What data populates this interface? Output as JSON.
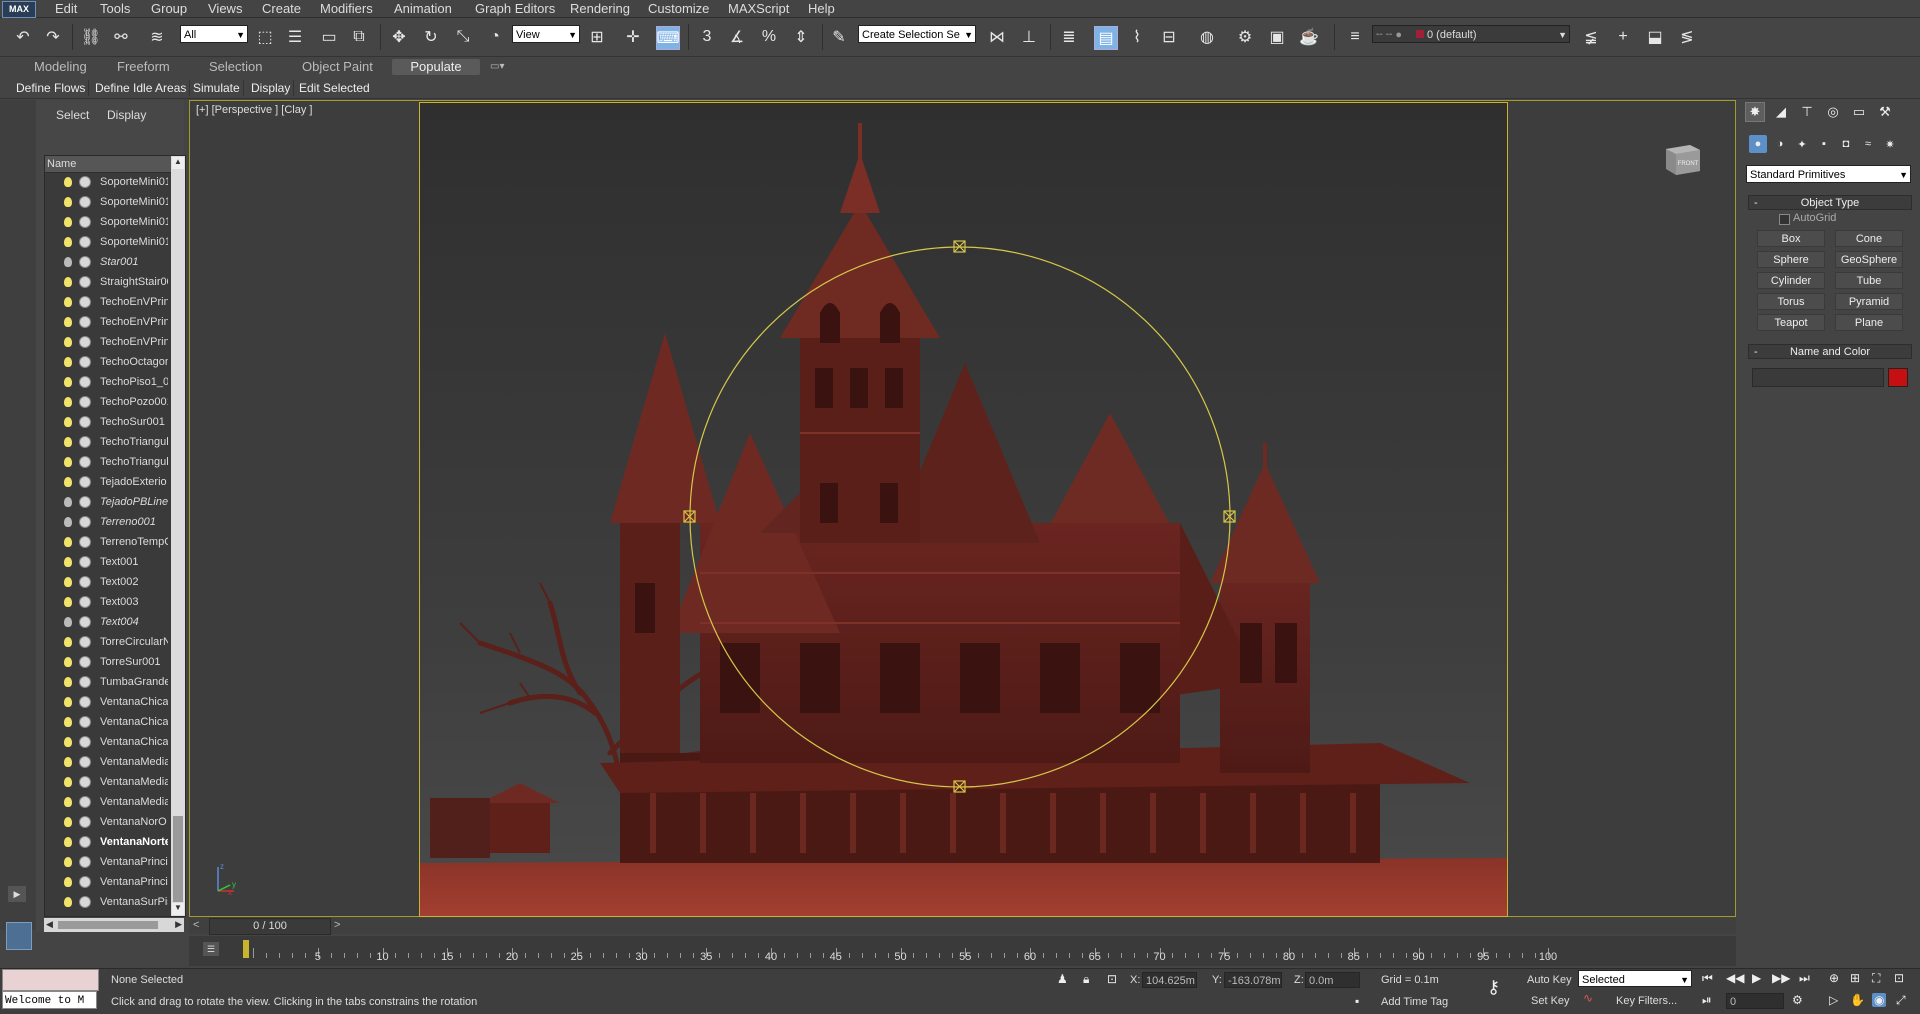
{
  "app": {
    "logo": "MAX"
  },
  "menu": [
    "Edit",
    "Tools",
    "Group",
    "Views",
    "Create",
    "Modifiers",
    "Animation",
    "Graph Editors",
    "Rendering",
    "Customize",
    "MAXScript",
    "Help"
  ],
  "toolbar": {
    "selection_filter": "All",
    "ref_coord": "View",
    "named_selection_placeholder": "Create Selection Se",
    "layer": "0 (default)"
  },
  "ribbon": {
    "tabs": [
      "Modeling",
      "Freeform",
      "Selection",
      "Object Paint",
      "Populate"
    ],
    "active_tab": "Populate",
    "buttons": [
      "Define Flows",
      "Define Idle Areas",
      "Simulate",
      "Display",
      "Edit Selected"
    ]
  },
  "scene_explorer": {
    "tabs": [
      "Select",
      "Display"
    ],
    "column_header": "Name",
    "items": [
      {
        "name": "SoporteMini01",
        "style": "normal",
        "light": true
      },
      {
        "name": "SoporteMini01",
        "style": "normal",
        "light": true
      },
      {
        "name": "SoporteMini01",
        "style": "normal",
        "light": true
      },
      {
        "name": "SoporteMini01",
        "style": "normal",
        "light": true
      },
      {
        "name": "Star001",
        "style": "italic",
        "light": false
      },
      {
        "name": "StraightStair00",
        "style": "normal",
        "light": true
      },
      {
        "name": "TechoEnVPrinc",
        "style": "normal",
        "light": true
      },
      {
        "name": "TechoEnVPrinc",
        "style": "normal",
        "light": true
      },
      {
        "name": "TechoEnVPrinc",
        "style": "normal",
        "light": true
      },
      {
        "name": "TechoOctagon",
        "style": "normal",
        "light": true
      },
      {
        "name": "TechoPiso1_00",
        "style": "normal",
        "light": true
      },
      {
        "name": "TechoPozo001",
        "style": "normal",
        "light": true
      },
      {
        "name": "TechoSur001",
        "style": "normal",
        "light": true
      },
      {
        "name": "TechoTriangul",
        "style": "normal",
        "light": true
      },
      {
        "name": "TechoTriangul",
        "style": "normal",
        "light": true
      },
      {
        "name": "TejadoExterio",
        "style": "normal",
        "light": true
      },
      {
        "name": "TejadoPBLine",
        "style": "italic",
        "light": false
      },
      {
        "name": "Terreno001",
        "style": "italic",
        "light": false
      },
      {
        "name": "TerrenoTempC",
        "style": "normal",
        "light": true
      },
      {
        "name": "Text001",
        "style": "normal",
        "light": true
      },
      {
        "name": "Text002",
        "style": "normal",
        "light": true
      },
      {
        "name": "Text003",
        "style": "normal",
        "light": true
      },
      {
        "name": "Text004",
        "style": "italic",
        "light": false
      },
      {
        "name": "TorreCircularN",
        "style": "normal",
        "light": true
      },
      {
        "name": "TorreSur001",
        "style": "normal",
        "light": true
      },
      {
        "name": "TumbaGrande",
        "style": "normal",
        "light": true
      },
      {
        "name": "VentanaChica",
        "style": "normal",
        "light": true
      },
      {
        "name": "VentanaChica",
        "style": "normal",
        "light": true
      },
      {
        "name": "VentanaChica",
        "style": "normal",
        "light": true
      },
      {
        "name": "VentanaMedia",
        "style": "normal",
        "light": true
      },
      {
        "name": "VentanaMedia",
        "style": "normal",
        "light": true
      },
      {
        "name": "VentanaMedia",
        "style": "normal",
        "light": true
      },
      {
        "name": "VentanaNorO",
        "style": "normal",
        "light": true
      },
      {
        "name": "VentanaNorte",
        "style": "bold",
        "light": true
      },
      {
        "name": "VentanaPrinci",
        "style": "normal",
        "light": true
      },
      {
        "name": "VentanaPrinci",
        "style": "normal",
        "light": true
      },
      {
        "name": "VentanaSurPis",
        "style": "normal",
        "light": true
      }
    ]
  },
  "viewport": {
    "label": "[+] [Perspective ] [Clay ]",
    "viewcube_label": "FRONT"
  },
  "command_panel": {
    "category": "Standard Primitives",
    "object_type_title": "Object Type",
    "autogrid_label": "AutoGrid",
    "primitives": [
      "Box",
      "Cone",
      "Sphere",
      "GeoSphere",
      "Cylinder",
      "Tube",
      "Torus",
      "Pyramid",
      "Teapot",
      "Plane"
    ],
    "name_color_title": "Name and Color",
    "object_color": "#c41010"
  },
  "timeline": {
    "frame_display": "0 / 100",
    "ticks": [
      "5",
      "10",
      "15",
      "20",
      "25",
      "30",
      "35",
      "40",
      "45",
      "50",
      "55",
      "60",
      "65",
      "70",
      "75",
      "80",
      "85",
      "90",
      "95",
      "100"
    ]
  },
  "status": {
    "maxscript_listener": "Welcome to M",
    "selection_status": "None Selected",
    "prompt": "Click and drag to rotate the view.  Clicking in the tabs constrains the rotation",
    "x_label": "X:",
    "x_value": "104.625m",
    "y_label": "Y:",
    "y_value": "-163.078m",
    "z_label": "Z:",
    "z_value": "0.0m",
    "grid": "Grid = 0.1m",
    "add_time_tag": "Add Time Tag",
    "auto_key": "Auto Key",
    "set_key": "Set Key",
    "key_mode": "Selected",
    "key_filters": "Key Filters...",
    "current_frame": "0"
  },
  "colors": {
    "viewport_border": "#a49a2a",
    "gizmo": "#d6c64a",
    "model": "#7a2a22",
    "active_toolbar": "#7fb3e6"
  }
}
